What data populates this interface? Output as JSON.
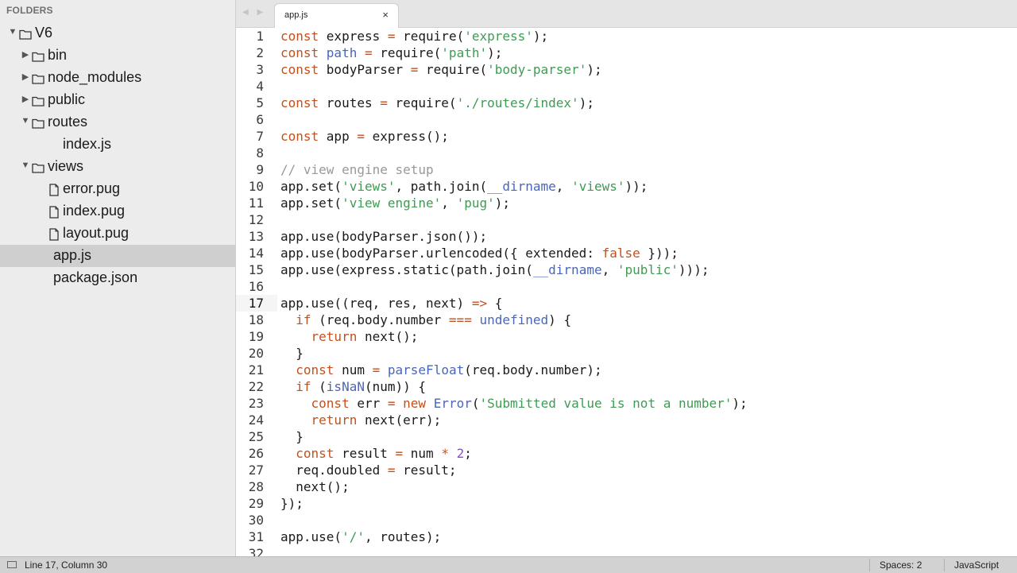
{
  "sidebar": {
    "header": "FOLDERS",
    "items": [
      {
        "label": "V6",
        "type": "folder",
        "expanded": true,
        "depth": 0
      },
      {
        "label": "bin",
        "type": "folder",
        "expanded": false,
        "depth": 1
      },
      {
        "label": "node_modules",
        "type": "folder",
        "expanded": false,
        "depth": 1
      },
      {
        "label": "public",
        "type": "folder",
        "expanded": false,
        "depth": 1
      },
      {
        "label": "routes",
        "type": "folder",
        "expanded": true,
        "depth": 1
      },
      {
        "label": "index.js",
        "type": "file",
        "depth": 2
      },
      {
        "label": "views",
        "type": "folder",
        "expanded": true,
        "depth": 1
      },
      {
        "label": "error.pug",
        "type": "file-icon",
        "depth": 2
      },
      {
        "label": "index.pug",
        "type": "file-icon",
        "depth": 2
      },
      {
        "label": "layout.pug",
        "type": "file-icon",
        "depth": 2
      },
      {
        "label": "app.js",
        "type": "file",
        "depth": 1,
        "selected": true
      },
      {
        "label": "package.json",
        "type": "file",
        "depth": 1
      }
    ]
  },
  "tabs": [
    {
      "title": "app.js",
      "close": "×",
      "active": true
    }
  ],
  "editor": {
    "active_line": 17,
    "lines": [
      {
        "n": "1",
        "segs": [
          [
            "kw",
            "const"
          ],
          [
            "",
            "express"
          ],
          [
            "op",
            " = "
          ],
          [
            "",
            "require("
          ],
          [
            "str",
            "'express'"
          ],
          [
            "",
            ");"
          ]
        ]
      },
      {
        "n": "2",
        "segs": [
          [
            "kw",
            "const"
          ],
          [
            "fn",
            "path"
          ],
          [
            "op",
            " = "
          ],
          [
            "",
            "require("
          ],
          [
            "str",
            "'path'"
          ],
          [
            "",
            ");"
          ]
        ]
      },
      {
        "n": "3",
        "segs": [
          [
            "kw",
            "const"
          ],
          [
            "",
            "bodyParser"
          ],
          [
            "op",
            " = "
          ],
          [
            "",
            "require("
          ],
          [
            "str",
            "'body-parser'"
          ],
          [
            "",
            ");"
          ]
        ]
      },
      {
        "n": "4",
        "segs": []
      },
      {
        "n": "5",
        "segs": [
          [
            "kw",
            "const"
          ],
          [
            "",
            "routes"
          ],
          [
            "op",
            " = "
          ],
          [
            "",
            "require("
          ],
          [
            "str",
            "'./routes/index'"
          ],
          [
            "",
            ");"
          ]
        ]
      },
      {
        "n": "6",
        "segs": []
      },
      {
        "n": "7",
        "segs": [
          [
            "kw",
            "const"
          ],
          [
            "",
            "app"
          ],
          [
            "op",
            " = "
          ],
          [
            "",
            "express();"
          ]
        ]
      },
      {
        "n": "8",
        "segs": []
      },
      {
        "n": "9",
        "segs": [
          [
            "cm",
            "// view engine setup"
          ]
        ]
      },
      {
        "n": "10",
        "segs": [
          [
            "",
            "app.set("
          ],
          [
            "str",
            "'views'"
          ],
          [
            "",
            ", path.join("
          ],
          [
            "bi",
            "__dirname"
          ],
          [
            "",
            ", "
          ],
          [
            "str",
            "'views'"
          ],
          [
            "",
            "));"
          ]
        ]
      },
      {
        "n": "11",
        "segs": [
          [
            "",
            "app.set("
          ],
          [
            "str",
            "'view engine'"
          ],
          [
            "",
            ", "
          ],
          [
            "str",
            "'pug'"
          ],
          [
            "",
            ");"
          ]
        ]
      },
      {
        "n": "12",
        "segs": []
      },
      {
        "n": "13",
        "segs": [
          [
            "",
            "app.use(bodyParser.json());"
          ]
        ]
      },
      {
        "n": "14",
        "segs": [
          [
            "",
            "app.use(bodyParser.urlencoded({ extended: "
          ],
          [
            "kw",
            "false"
          ],
          [
            "",
            " }));"
          ]
        ]
      },
      {
        "n": "15",
        "segs": [
          [
            "",
            "app.use(express.static(path.join("
          ],
          [
            "bi",
            "__dirname"
          ],
          [
            "",
            ", "
          ],
          [
            "str",
            "'public'"
          ],
          [
            "",
            ")));"
          ]
        ]
      },
      {
        "n": "16",
        "segs": []
      },
      {
        "n": "17",
        "segs": [
          [
            "",
            "app.use((req, res, next) "
          ],
          [
            "op",
            "=>"
          ],
          [
            "",
            " {"
          ]
        ]
      },
      {
        "n": "18",
        "segs": [
          [
            "",
            "  "
          ],
          [
            "kw",
            "if"
          ],
          [
            "",
            " (req.body.number "
          ],
          [
            "op",
            "==="
          ],
          [
            "",
            " "
          ],
          [
            "bi",
            "undefined"
          ],
          [
            "",
            ") {"
          ]
        ]
      },
      {
        "n": "19",
        "segs": [
          [
            "",
            "    "
          ],
          [
            "kw",
            "return"
          ],
          [
            "",
            " next();"
          ]
        ]
      },
      {
        "n": "20",
        "segs": [
          [
            "",
            "  }"
          ]
        ]
      },
      {
        "n": "21",
        "segs": [
          [
            "",
            "  "
          ],
          [
            "kw",
            "const"
          ],
          [
            "",
            " num "
          ],
          [
            "op",
            "="
          ],
          [
            "",
            " "
          ],
          [
            "fn",
            "parseFloat"
          ],
          [
            "",
            "(req.body.number);"
          ]
        ]
      },
      {
        "n": "22",
        "segs": [
          [
            "",
            "  "
          ],
          [
            "kw",
            "if"
          ],
          [
            "",
            " ("
          ],
          [
            "fn",
            "isNaN"
          ],
          [
            "",
            "(num)) {"
          ]
        ]
      },
      {
        "n": "23",
        "segs": [
          [
            "",
            "    "
          ],
          [
            "kw",
            "const"
          ],
          [
            "",
            " err "
          ],
          [
            "op",
            "="
          ],
          [
            "",
            " "
          ],
          [
            "kw",
            "new"
          ],
          [
            "",
            " "
          ],
          [
            "fn",
            "Error"
          ],
          [
            "",
            "("
          ],
          [
            "str",
            "'Submitted value is not a number'"
          ],
          [
            "",
            ");"
          ]
        ]
      },
      {
        "n": "24",
        "segs": [
          [
            "",
            "    "
          ],
          [
            "kw",
            "return"
          ],
          [
            "",
            " next(err);"
          ]
        ]
      },
      {
        "n": "25",
        "segs": [
          [
            "",
            "  }"
          ]
        ]
      },
      {
        "n": "26",
        "segs": [
          [
            "",
            "  "
          ],
          [
            "kw",
            "const"
          ],
          [
            "",
            " result "
          ],
          [
            "op",
            "="
          ],
          [
            "",
            " num "
          ],
          [
            "op",
            "*"
          ],
          [
            "",
            " "
          ],
          [
            "num",
            "2"
          ],
          [
            "",
            ";"
          ]
        ]
      },
      {
        "n": "27",
        "segs": [
          [
            "",
            "  req.doubled "
          ],
          [
            "op",
            "="
          ],
          [
            "",
            " result;"
          ]
        ]
      },
      {
        "n": "28",
        "segs": [
          [
            "",
            "  next();"
          ]
        ]
      },
      {
        "n": "29",
        "segs": [
          [
            "",
            "});"
          ]
        ]
      },
      {
        "n": "30",
        "segs": []
      },
      {
        "n": "31",
        "segs": [
          [
            "",
            "app.use("
          ],
          [
            "str",
            "'/'"
          ],
          [
            "",
            ", routes);"
          ]
        ]
      },
      {
        "n": "32",
        "segs": []
      }
    ]
  },
  "statusbar": {
    "position": "Line 17, Column 30",
    "indent": "Spaces: 2",
    "syntax": "JavaScript"
  },
  "colors": {
    "keyword": "#c3501d",
    "string": "#3f9b53",
    "comment": "#999999",
    "function": "#4a66b8",
    "number": "#8a4fc3"
  }
}
